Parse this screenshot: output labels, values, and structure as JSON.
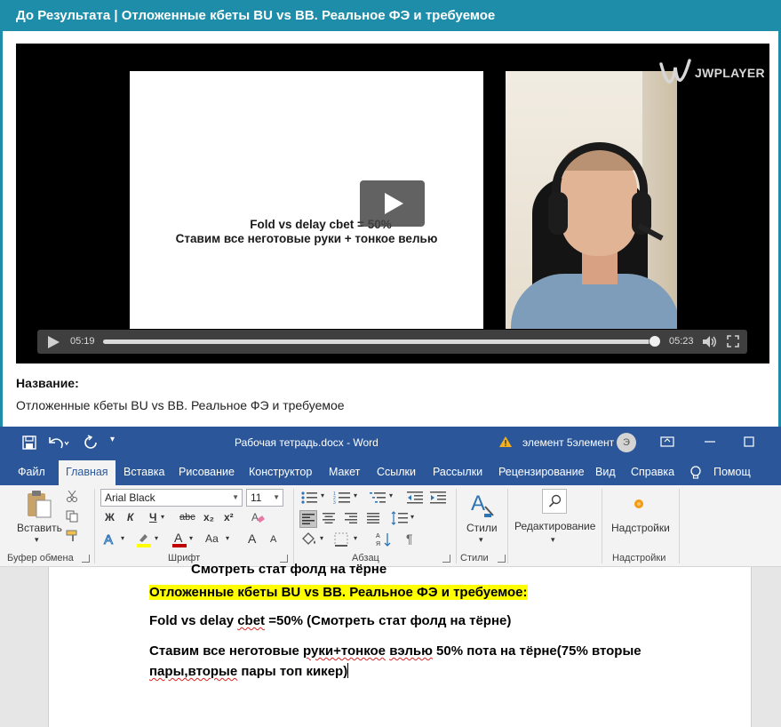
{
  "lesson": {
    "header_title": "До Результата | Отложенные кбеты BU vs BB. Реальное ФЭ и требуемое"
  },
  "player": {
    "slide_line1": "Fold vs delay cbet = 50%",
    "slide_line2": "Ставим все неготовые руки + тонкое велью",
    "brand": "JWPLAYER",
    "elapsed": "05:19",
    "duration": "05:23",
    "progress_percent": 98.7,
    "icons": [
      "play-icon",
      "volume-icon",
      "fullscreen-icon",
      "jwplayer-logo"
    ]
  },
  "info": {
    "name_label": "Название:",
    "name_value": "Отложенные кбеты BU vs BB. Реальное ФЭ и требуемое"
  },
  "word": {
    "title": "Рабочая тетрадь.docx  -  Word",
    "warning_text": "элемент 5элемент",
    "user_initial": "Э",
    "tabs": [
      "Файл",
      "Главная",
      "Вставка",
      "Рисование",
      "Конструктор",
      "Макет",
      "Ссылки",
      "Рассылки",
      "Рецензирование",
      "Вид",
      "Справка",
      "Помощ"
    ],
    "ribbon": {
      "paste_label": "Вставить",
      "clipboard_label": "Буфер обмена",
      "font_name": "Arial Black",
      "font_size": "11",
      "bold": "Ж",
      "italic": "К",
      "underline": "Ч",
      "strike": "abc",
      "subscript": "x₂",
      "superscript": "x²",
      "case_label": "Аа",
      "grow": "A",
      "shrink": "A",
      "font_group": "Шрифт",
      "paragraph_group": "Абзац",
      "styles_label": "Стили",
      "styles_group": "Стили",
      "editing_label": "Редактирование",
      "addins_label": "Надстройки",
      "addins_group": "Надстройки",
      "pilcrow": "¶"
    },
    "doc": {
      "cut_line": "Смотреть стат фолд на тёрне",
      "line1": "Отложенные кбеты BU vs BB. Реальное ФЭ и требуемое:",
      "line2_a": "Fold vs delay ",
      "line2_b": "cbet",
      "line2_c": " =50% (Смотреть стат фолд на тёрне)",
      "line3_a": "Ставим все неготовые ",
      "line3_b": "руки+тонкое",
      "line3_c": " ",
      "line3_d": "вэлью",
      "line3_e": " 50% пота на тёрне(75% вторые",
      "line4_a": "пары,вторые",
      "line4_b": " пары топ кикер)"
    },
    "colors": {
      "title_bar": "#2b579a",
      "highlight": "#ffff00"
    }
  }
}
